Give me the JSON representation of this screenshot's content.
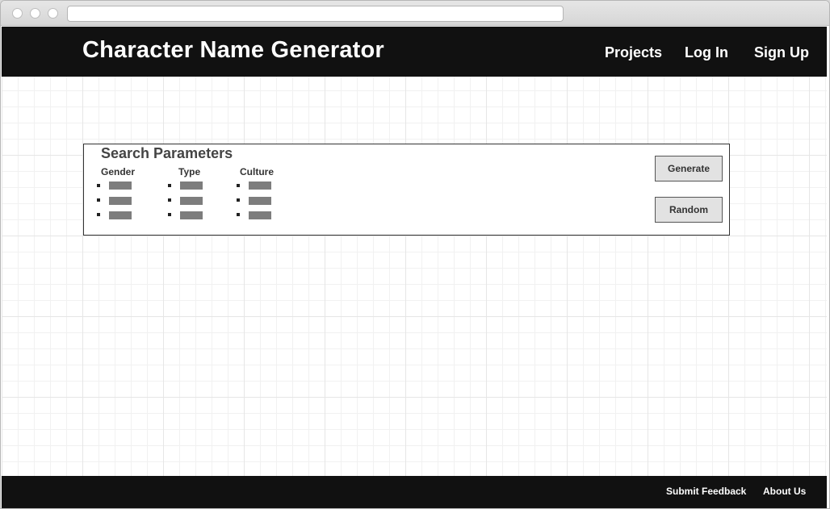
{
  "header": {
    "title": "Character Name Generator",
    "nav": [
      "Projects",
      "Log In",
      "Sign Up"
    ]
  },
  "search_panel": {
    "title": "Search Parameters",
    "columns": [
      {
        "label": "Gender",
        "options": 3
      },
      {
        "label": "Type",
        "options": 3
      },
      {
        "label": "Culture",
        "options": 3
      }
    ],
    "generate_label": "Generate",
    "random_label": "Random"
  },
  "footer": {
    "links": [
      "Submit Feedback",
      "About Us"
    ]
  },
  "colors": {
    "header_bg": "#111111",
    "placeholder_bar": "#7d7d7d",
    "button_bg": "#e2e2e2"
  }
}
